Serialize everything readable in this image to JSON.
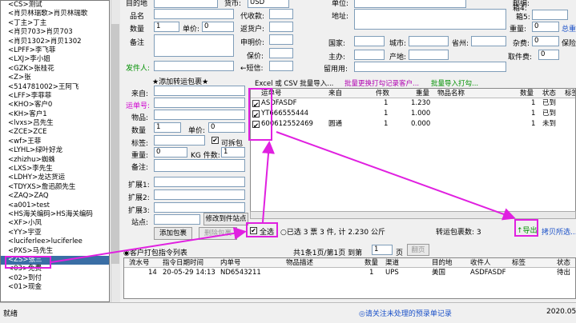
{
  "sidebar": {
    "items": [
      "<CS>测试",
      "<肖贝林瑞歌>肖贝林瑞歌",
      "<丁主>丁主",
      "<肖贝703>肖贝703",
      "<肖贝1302>肖贝1302",
      "<LPFF>李飞菲",
      "<LXJ>李小姐",
      "<GZK>张桂花",
      "<Z>张",
      "<514781002>王阿飞",
      "<LFF>李菲菲",
      "<KHO>客户0",
      "<KH>客户1",
      "<lvxs>吕先生",
      "<ZCE>ZCE",
      "<wf>王菲",
      "<LYHL>绿叶好龙",
      "<zhizhu>蜘蛛",
      "<LXS>李先生",
      "<LDHY>龙达货运",
      "<TDYXS>詹迅颜先生",
      "<ZAQ>ZAQ",
      "<a001>test",
      "<HS海关编码>HS海关编码",
      "<XF>小凤",
      "<YY>宇亚",
      "<luciferlee>luciferlee",
      "<PXS>马先生",
      "<ZS>张三",
      "<03>免费",
      "<02>到付",
      "<01>现金"
    ],
    "selected_index": 28
  },
  "top_form": {
    "row0_labels": [
      "目的地",
      "货币:",
      "单位:",
      "邮编:"
    ],
    "currency_value": "USD",
    "name_label": "品名",
    "code_label": "代收款:",
    "address_label": "地址:",
    "box_label": "箱4:",
    "box5_label": "箱5:",
    "qty_label": "数量",
    "qty_value": "1",
    "unit_label": "单价:",
    "unit_value": "0",
    "insurance_label": "返货户:",
    "remark_label": "备注",
    "declare_label": "申明价:",
    "country_label": "国家:",
    "city_label": "城市:",
    "province_label": "省州:",
    "weight_label": "重量:",
    "weight_value": "0",
    "total_label": "总重",
    "insure_label": "保价:",
    "subject_label": "主办:",
    "producer_label": "产地:",
    "misc_fee_label": "杂费:",
    "misc_fee_value": "0",
    "protect_label": "保险",
    "sender_label": "发件人:",
    "sms_label": "←短信:",
    "phone_label": "留用用:",
    "pickup_fee_label": "取件费:",
    "pickup_fee_value": "0"
  },
  "transfer": {
    "title": "★添加转运包裹★",
    "from_label": "来自:",
    "tracking_label": "运单号:",
    "goods_label": "物品:",
    "qty_label": "数量",
    "qty_value": "1",
    "unit_label": "单价:",
    "unit_value": "0",
    "tag_label": "标签:",
    "split_label": "可拆包",
    "weight_label": "重量:",
    "weight_value": "0",
    "kg_label": "KG 件数:",
    "pieces_value": "1",
    "remark_label": "备注:",
    "ext1_label": "扩展1:",
    "ext2_label": "扩展2:",
    "ext3_label": "扩展3:",
    "station_label": "站点:",
    "modify_button": "修改到件站点",
    "add_button": "添加包裹",
    "delete_button": "删除包裹"
  },
  "toolbar": {
    "import_excel": "Excel 或 CSV 批量导入...",
    "batch_print": "批量更换打勾记录客户...",
    "batch_import_print": "批量导入打勾..."
  },
  "package_grid": {
    "columns": [
      "运单号",
      "来自",
      "件数",
      "重量",
      "物品名称",
      "数量",
      "状态",
      "标签"
    ],
    "rows": [
      {
        "checked": "✔",
        "tracking": "ASDFASDF",
        "from": "",
        "pieces": "1",
        "weight": "1.230",
        "goods": "",
        "qty": "1",
        "status": "已到"
      },
      {
        "checked": "✔",
        "tracking": "YT666555444",
        "from": "",
        "pieces": "1",
        "weight": "1.000",
        "goods": "",
        "qty": "1",
        "status": "已到"
      },
      {
        "checked": "✔",
        "tracking": "600612552469",
        "from": "圆通",
        "pieces": "1",
        "weight": "0.000",
        "goods": "",
        "qty": "1",
        "status": "未到"
      }
    ]
  },
  "summary": {
    "select_all": "全选",
    "unselected": "○已选 3 票 3 件, 计 2.230 公斤",
    "transport_count": "转运包裹数: 3",
    "export": "导出",
    "copy_selected": "拷贝所选..."
  },
  "instruction": {
    "title": "◉客户打包指令列表",
    "pager": "共1条1页/第1页 到第",
    "page_value": "1",
    "page_unit": "页",
    "page_button": "翻页"
  },
  "order_grid": {
    "columns": [
      "流水号",
      "指令日期时间",
      "内单号",
      "物品描述",
      "数量",
      "渠道",
      "目的地",
      "收件人",
      "标签",
      "状态"
    ],
    "rows": [
      {
        "id": "14",
        "date": "20-05-29 14:13",
        "inner": "ND6543211",
        "desc": "",
        "qty": "1",
        "channel": "UPS",
        "dest": "美国",
        "recipient": "ASDFASDF",
        "tag": "",
        "status": "待出"
      }
    ]
  },
  "statusbar": {
    "left": "就绪",
    "notice": "◎请关注未处理的预录单记录",
    "date": "2020.05."
  },
  "colors": {
    "accent": "#e020e0",
    "selected": "#3a6ea5"
  }
}
